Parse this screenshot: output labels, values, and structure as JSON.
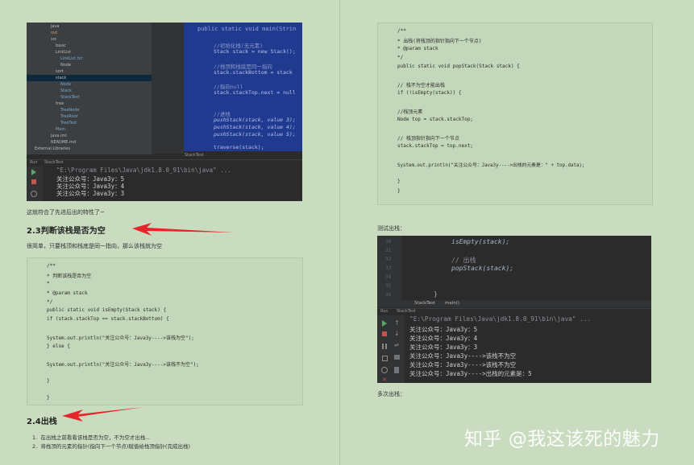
{
  "left": {
    "ide_top": {
      "tree": [
        "java",
        "out",
        "src",
        "basic",
        "LinkList",
        "LinkList.txt",
        "Node",
        "sort",
        "stack",
        "Node",
        "Stack",
        "StackTest",
        "tree",
        "TreeNode",
        "TreeRoot",
        "TreeTest",
        "Main",
        "java.iml",
        "README.md",
        "External Libraries"
      ],
      "code_lines": [
        "public static void main(Strin",
        "//初始化栈(无元素)",
        "Stack stack = new Stack();",
        "//栈顶和栈底是同一指向",
        "stack.stackBottom = stack",
        "//指向null",
        "stack.stackTop.next = null",
        "//进栈",
        "pushStack(stack,  value 3);",
        "pushStack(stack,  value 4);",
        "pushStack(stack,  value 5);",
        "traverse(stack);"
      ],
      "editor_tab": "StackTest",
      "run_tab": "StackTest",
      "run_label": "Run",
      "console": [
        "\"E:\\Program Files\\Java\\jdk1.8.0_91\\bin\\java\" ...",
        "关注公众号：Java3y：5",
        "关注公众号：Java3y：4",
        "关注公众号：Java3y：3"
      ]
    },
    "caption1": "这就符合了先进后出的特性了~",
    "heading1": "2.3判断该栈是否为空",
    "para1": "很简单，只要栈顶和栈底是同一指向，那么该栈就为空",
    "code1": [
      "/**",
      " * 判断该栈是否为空",
      " *",
      " * @param stack",
      " */",
      "public static void isEmpty(Stack stack) {",
      "    if (stack.stackTop == stack.stackBottom) {",
      "        System.out.println(\"关注公众号：Java3y---->该栈为空\");",
      "    } else {",
      "        System.out.println(\"关注公众号：Java3y---->该栈不为空\");",
      "    }",
      "}"
    ],
    "heading2": "2.4出栈",
    "list": [
      "在出栈之前看看该栈是否为空，不为空才出栈...",
      "将栈顶的元素的指针(指向下一个节点)赋值给栈顶指针(完成出栈)"
    ]
  },
  "right": {
    "code2": [
      "/**",
      " * 出栈(将栈顶的指针指向下一个节点)",
      " * @param stack",
      " */",
      "public static void popStack(Stack stack) {",
      "    // 栈不为空才能出栈",
      "    if (!isEmpty(stack)) {",
      "        //栈顶元素",
      "        Node top = stack.stackTop;",
      "        // 栈顶指针指向下一个节点",
      "        stack.stackTop = top.next;",
      "        System.out.println(\"关注公众号：Java3y---->出栈的元素是：\" + top.data);",
      "    }",
      "}"
    ],
    "caption2": "测试出栈：",
    "ide_bottom": {
      "line_numbers": [
        "30",
        "31",
        "32",
        "33",
        "34",
        "35",
        "36"
      ],
      "code_lines": [
        "isEmpty(stack);",
        "// 出栈",
        "popStack(stack);",
        "}"
      ],
      "breadcrumb": [
        "StackTest",
        "main()"
      ],
      "run_label": "Run",
      "run_tab": "StackTest",
      "console": [
        "\"E:\\Program Files\\Java\\jdk1.8.0_91\\bin\\java\" ...",
        "关注公众号：Java3y：5",
        "关注公众号：Java3y：4",
        "关注公众号：Java3y：3",
        "关注公众号：Java3y---->该栈不为空",
        "关注公众号：Java3y---->该栈不为空",
        "关注公众号：Java3y---->出栈的元素是：5"
      ]
    },
    "caption3": "多次出栈：",
    "watermark": "知乎 @我这该死的魅力"
  },
  "colors": {
    "background": "#c9dcc0",
    "arrow": "#e3262a",
    "ide_dark": "#2b2b2b",
    "selection": "#1f3a8f"
  }
}
